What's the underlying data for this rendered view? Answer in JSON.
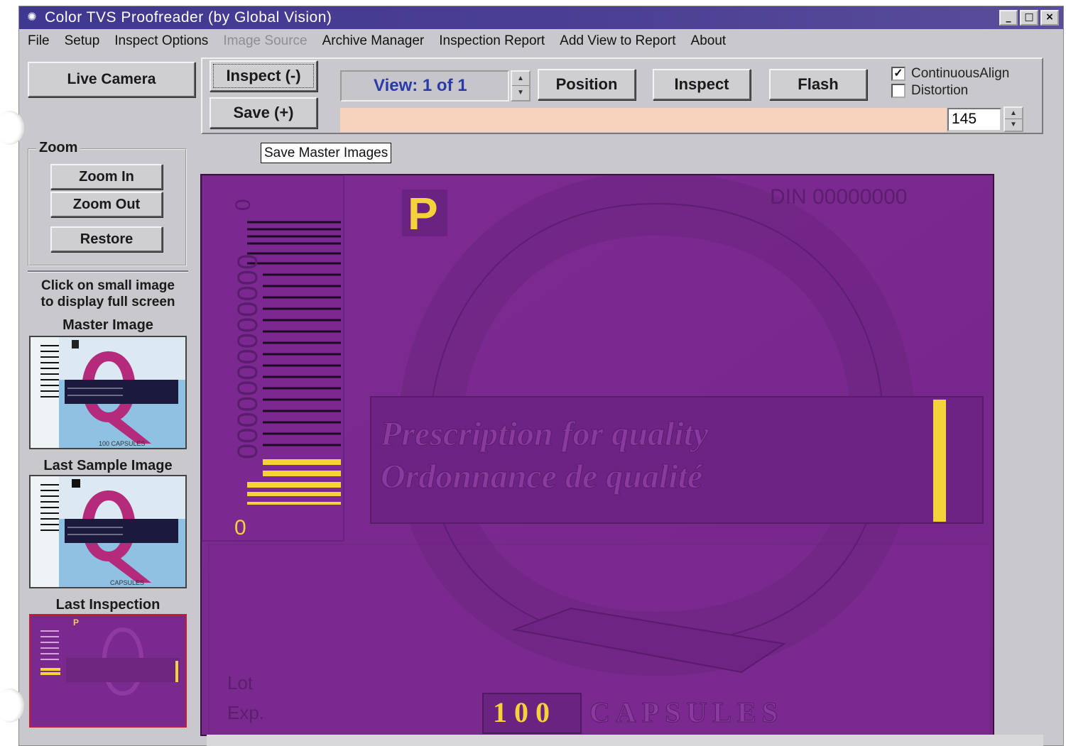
{
  "window": {
    "title": "Color TVS Proofreader (by Global Vision)",
    "controls": [
      "_",
      "□",
      "×"
    ]
  },
  "menu": {
    "items": [
      "File",
      "Setup",
      "Inspect Options",
      "Image Source",
      "Archive Manager",
      "Inspection Report",
      "Add View to Report",
      "About"
    ],
    "disabled": [
      "Image Source"
    ]
  },
  "toolbar": {
    "live_camera": "Live Camera",
    "inspect_minus": "Inspect (-)",
    "save_plus": "Save (+)",
    "view_label": "View: 1 of 1",
    "position": "Position",
    "inspect": "Inspect",
    "flash": "Flash",
    "continuous_align": {
      "label": "ContinuousAlign",
      "checked": true
    },
    "distortion": {
      "label": "Distortion",
      "checked": false
    },
    "value": "145"
  },
  "tooltip": "Save Master Images",
  "zoom": {
    "group_label": "Zoom",
    "zoom_in": "Zoom In",
    "zoom_out": "Zoom Out",
    "restore": "Restore"
  },
  "sidebar": {
    "hint_line1": "Click on small image",
    "hint_line2": "to display full screen",
    "master_label": "Master Image",
    "sample_label": "Last Sample Image",
    "inspection_label": "Last Inspection"
  },
  "image": {
    "p_mark": "P",
    "din": "DIN 00000000",
    "barcode_digits": "0000000000000",
    "line1": "Prescription for quality",
    "line2": "Ordonnance de qualité",
    "lot": "Lot",
    "exp": "Exp.",
    "count": "100",
    "unit": "CAPSULES",
    "thumb_count_master": "100 CAPSULES",
    "thumb_count_sample": "CAPSULES"
  },
  "colors": {
    "titlebar": "#3f3890",
    "image_bg": "#7a2a8e",
    "highlight_yellow": "#f4d23a",
    "progress": "#f7d3bd",
    "view_text": "#2a3aa8"
  }
}
